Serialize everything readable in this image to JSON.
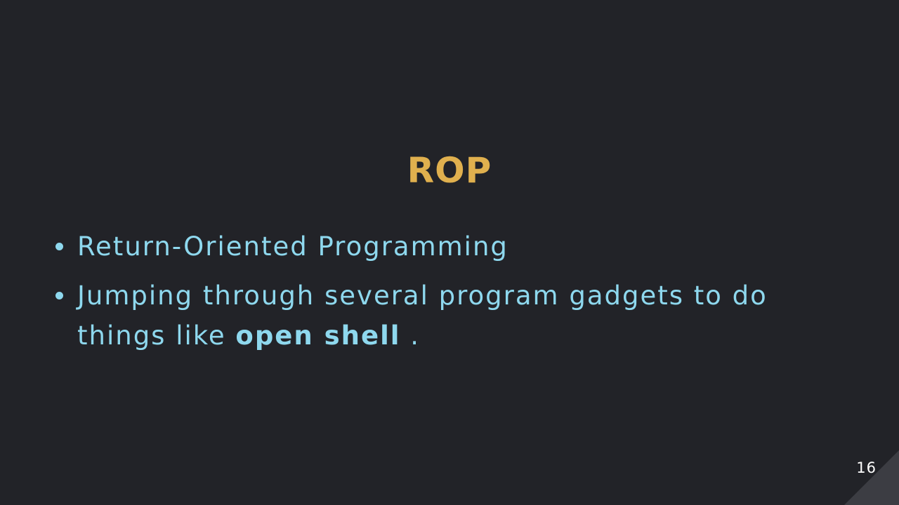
{
  "slide": {
    "title": "ROP",
    "bullets": [
      {
        "text": "Return-Oriented Programming"
      },
      {
        "text_before": "Jumping through several program gadgets to do things like ",
        "bold": "open shell",
        "text_after": " ."
      }
    ],
    "page_number": "16"
  },
  "colors": {
    "background": "#222328",
    "title": "#e0b04e",
    "body_text": "#8ed8ee",
    "corner_accent": "#3c3d43",
    "page_number": "#ffffff"
  }
}
